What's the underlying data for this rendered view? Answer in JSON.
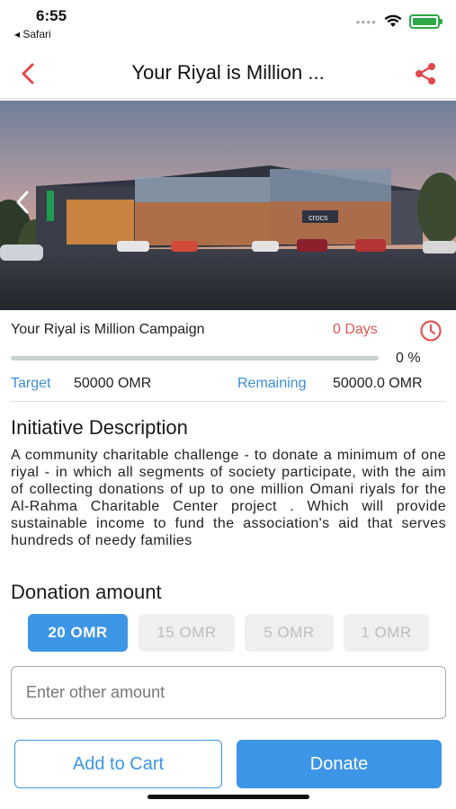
{
  "status_bar": {
    "time": "6:55",
    "back_app": "◂ Safari",
    "battery_color": "#2ea84a"
  },
  "nav": {
    "title": "Your Riyal is Million ...",
    "back_icon": "chevron-left-icon",
    "share_icon": "share-icon",
    "accent_color": "#e0474c"
  },
  "hero": {
    "icon": "chevron-left-icon",
    "sign_text": "crocs"
  },
  "campaign": {
    "title": "Your Riyal is Million Campaign",
    "days": "0 Days",
    "progress_text": "0 %",
    "progress_fraction": 0,
    "target_label": "Target",
    "target_value": "50000 OMR",
    "remaining_label": "Remaining",
    "remaining_value": "50000.0 OMR"
  },
  "description": {
    "heading": "Initiative Description",
    "body": "A community charitable challenge - to donate a minimum of one riyal - in which all segments of society participate, with the aim of collecting donations of up to one million Omani riyals for the Al-Rahma Charitable Center project . Which will provide sustainable income to fund the association's aid that serves hundreds of needy families"
  },
  "donation": {
    "heading": "Donation amount",
    "options": [
      {
        "label": "20  OMR",
        "selected": true
      },
      {
        "label": "15  OMR",
        "selected": false
      },
      {
        "label": "5  OMR",
        "selected": false
      },
      {
        "label": "1  OMR",
        "selected": false
      }
    ],
    "input_placeholder": "Enter other amount",
    "input_value": ""
  },
  "actions": {
    "add_to_cart": "Add to Cart",
    "donate": "Donate"
  },
  "colors": {
    "primary": "#3d95e6",
    "days_red": "#e25555",
    "label_blue": "#3a8fd8"
  }
}
